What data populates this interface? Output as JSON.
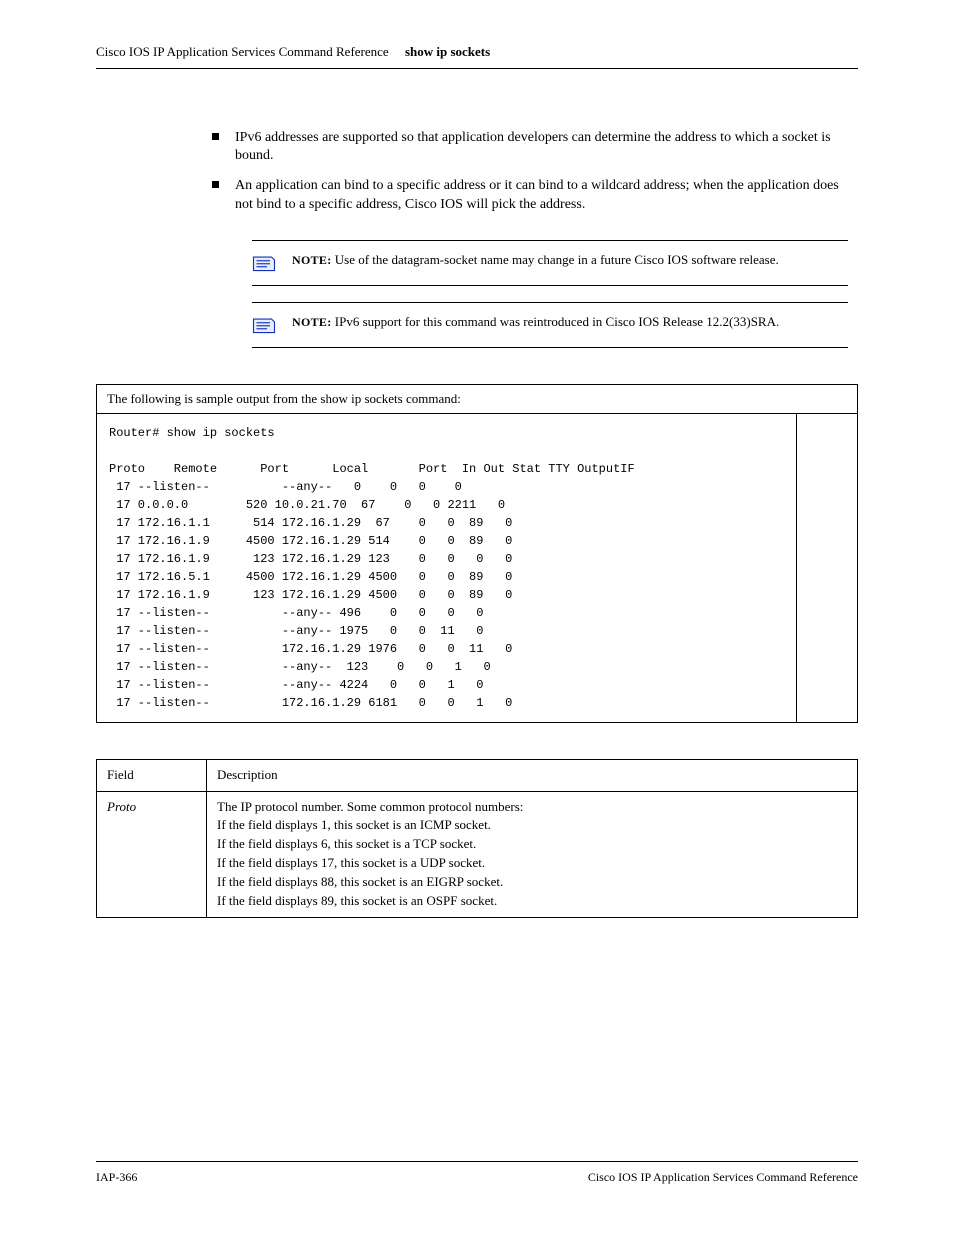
{
  "header": {
    "doc_title": "Cisco IOS IP Application Services Command Reference",
    "running_head": "show ip sockets"
  },
  "bullets": [
    "IPv6 addresses are supported so that application developers can determine the address to which a socket is bound.",
    "An application can bind to a specific address or it can bind to a wildcard address; when the application does not bind to a specific address, Cisco IOS will pick the address."
  ],
  "notes": [
    {
      "label": "NOTE:",
      "text": "Use of the datagram-socket name may change in a future Cisco IOS software release."
    },
    {
      "label": "NOTE:",
      "text": "IPv6 support for this command was reintroduced in Cisco IOS Release 12.2(33)SRA."
    }
  ],
  "output_example": {
    "caption": "The following is sample output from the show ip sockets command:",
    "lines": [
      "Router# show ip sockets",
      "",
      "Proto    Remote      Port      Local       Port  In Out Stat TTY OutputIF",
      " 17 --listen--          --any--   0    0   0    0",
      " 17 0.0.0.0        520 10.0.21.70  67    0   0 2211   0",
      " 17 172.16.1.1      514 172.16.1.29  67    0   0  89   0",
      " 17 172.16.1.9     4500 172.16.1.29 514    0   0  89   0",
      " 17 172.16.1.9      123 172.16.1.29 123    0   0   0   0",
      " 17 172.16.5.1     4500 172.16.1.29 4500   0   0  89   0",
      " 17 172.16.1.9      123 172.16.1.29 4500   0   0  89   0",
      " 17 --listen--          --any-- 496    0   0   0   0",
      " 17 --listen--          --any-- 1975   0   0  11   0",
      " 17 --listen--          172.16.1.29 1976   0   0  11   0",
      " 17 --listen--          --any--  123    0   0   1   0",
      " 17 --listen--          --any-- 4224   0   0   1   0",
      " 17 --listen--          172.16.1.29 6181   0   0   1   0"
    ]
  },
  "var_table": {
    "head": [
      "Field",
      "Description"
    ],
    "row": {
      "field": "Proto",
      "desc_lead": "The IP protocol number. Some common protocol numbers:",
      "desc_items": [
        "If the field displays 1, this socket is an ICMP socket.",
        "If the field displays 6, this socket is a TCP socket.",
        "If the field displays 17, this socket is a UDP socket.",
        "If the field displays 88, this socket is an EIGRP socket.",
        "If the field displays 89, this socket is an OSPF socket."
      ]
    }
  },
  "footer": {
    "page": "IAP-366",
    "right": "Cisco IOS IP Application Services Command Reference"
  }
}
